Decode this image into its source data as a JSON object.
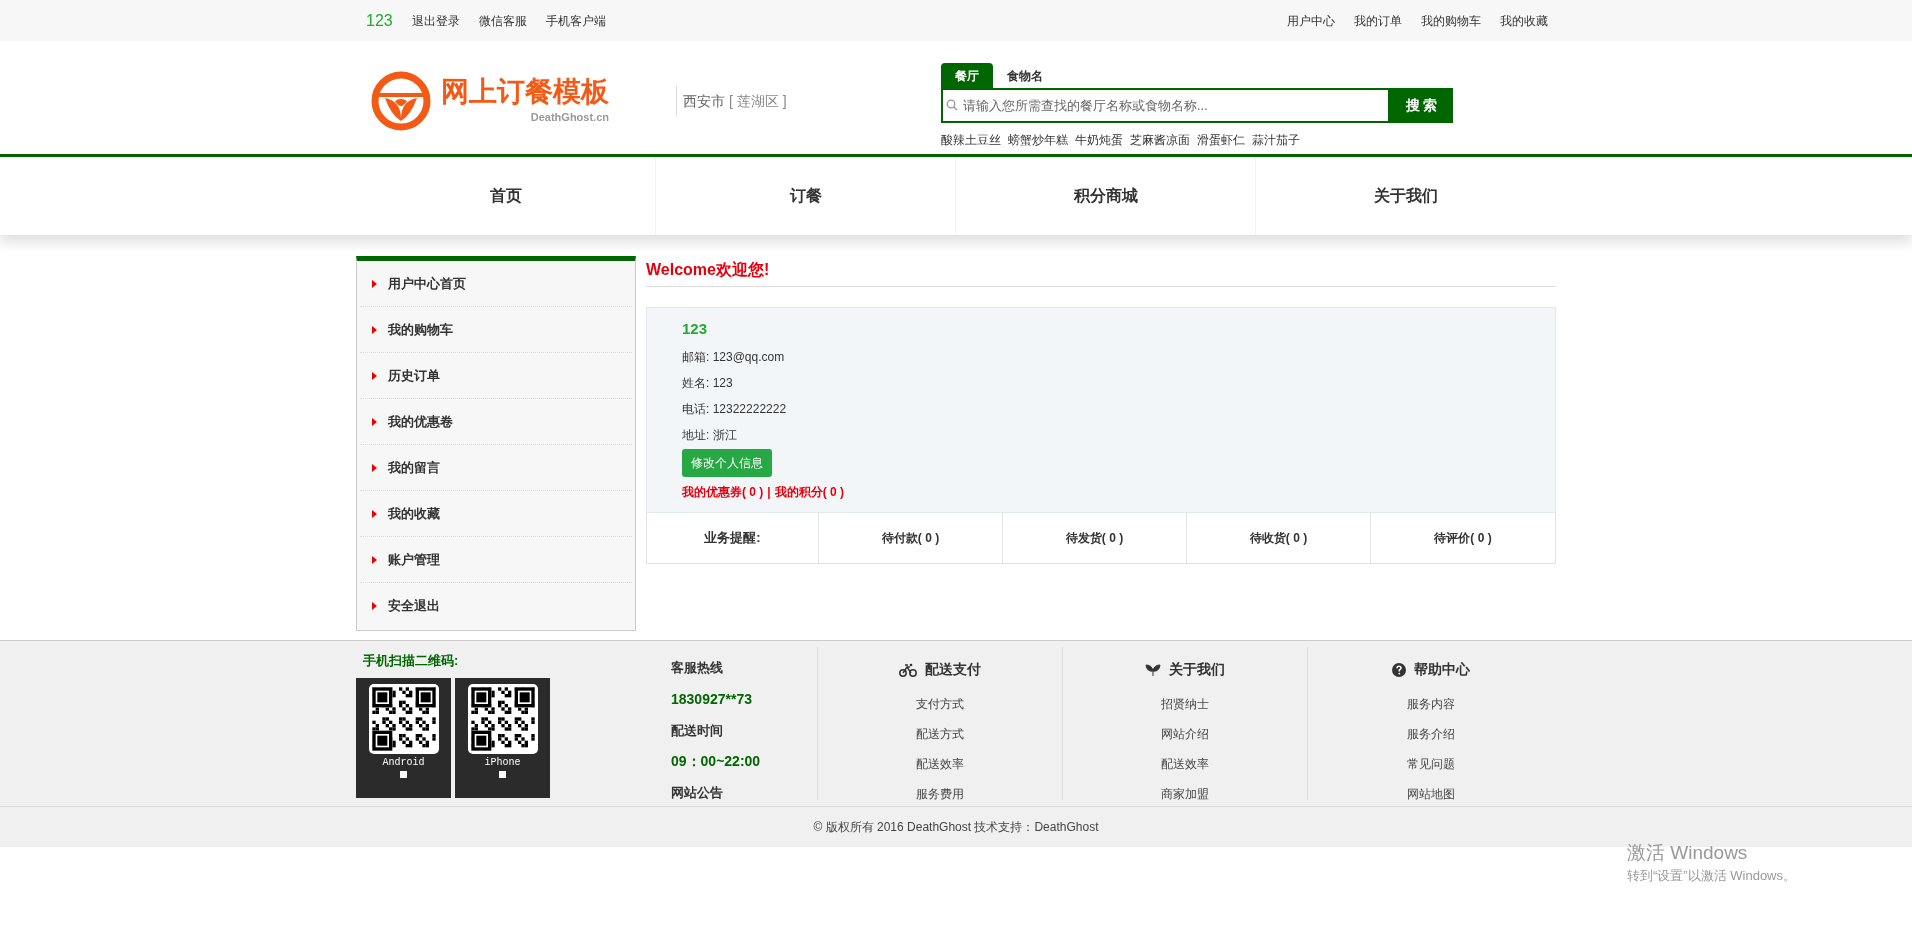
{
  "top_bar": {
    "user": "123",
    "links": [
      "退出登录",
      "微信客服",
      "手机客户端"
    ],
    "right_links": [
      "用户中心",
      "我的订单",
      "我的购物车",
      "我的收藏"
    ]
  },
  "header": {
    "logo_text": "网上订餐模板",
    "logo_subtext": "DeathGhost.cn",
    "location_city": "西安市",
    "location_district": "[ 莲湖区 ]",
    "search_tabs": [
      {
        "label": "餐厅",
        "selected": true
      },
      {
        "label": "食物名",
        "selected": false
      }
    ],
    "search_placeholder": "请输入您所需查找的餐厅名称或食物名称...",
    "search_button": "搜 索",
    "hot_keywords": [
      "酸辣土豆丝",
      "螃蟹炒年糕",
      "牛奶炖蛋",
      "芝麻酱凉面",
      "滑蛋虾仁",
      "蒜汁茄子"
    ]
  },
  "nav": [
    "首页",
    "订餐",
    "积分商城",
    "关于我们"
  ],
  "sidebar": [
    "用户中心首页",
    "我的购物车",
    "历史订单",
    "我的优惠卷",
    "我的留言",
    "我的收藏",
    "账户管理",
    "安全退出"
  ],
  "welcome": "Welcome欢迎您!",
  "profile": {
    "username": "123",
    "fields": [
      {
        "label": "邮箱:",
        "value": "123@qq.com"
      },
      {
        "label": "姓名:",
        "value": "123"
      },
      {
        "label": "电话:",
        "value": "12322222222"
      },
      {
        "label": "地址:",
        "value": "浙江"
      }
    ],
    "edit_button": "修改个人信息",
    "coupons": "我的优惠券( 0 )",
    "separator": "|",
    "points": "我的积分( 0 )"
  },
  "reminders": {
    "label": "业务提醒:",
    "items": [
      "待付款( 0 )",
      "待发货( 0 )",
      "待收货( 0 )",
      "待评价( 0 )"
    ]
  },
  "footer": {
    "qr_title": "手机扫描二维码:",
    "qr_codes": [
      {
        "label": "Android"
      },
      {
        "label": "iPhone"
      }
    ],
    "contact": [
      {
        "kind": "heading",
        "text": "客服热线"
      },
      {
        "kind": "value",
        "text": "1830927**73"
      },
      {
        "kind": "heading",
        "text": "配送时间"
      },
      {
        "kind": "value",
        "text": "09：00~22:00"
      },
      {
        "kind": "heading",
        "text": "网站公告"
      }
    ],
    "columns": [
      {
        "title": "配送支付",
        "links": [
          "支付方式",
          "配送方式",
          "配送效率",
          "服务费用"
        ]
      },
      {
        "title": "关于我们",
        "links": [
          "招贤纳士",
          "网站介绍",
          "配送效率",
          "商家加盟"
        ]
      },
      {
        "title": "帮助中心",
        "links": [
          "服务内容",
          "服务介绍",
          "常见问题",
          "网站地图"
        ]
      }
    ],
    "copyright": "© 版权所有 2016 DeathGhost 技术支持：DeathGhost"
  },
  "windows_activation": {
    "title": "激活 Windows",
    "subtitle": "转到“设置”以激活 Windows。"
  }
}
